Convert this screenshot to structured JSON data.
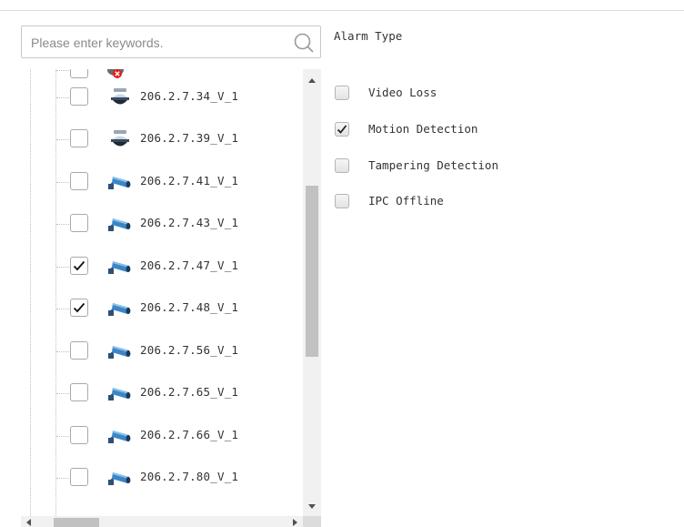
{
  "search": {
    "placeholder": "Please enter keywords."
  },
  "tree": {
    "items": [
      {
        "label": "206.2.7.34_V_1",
        "checked": false,
        "icon": "dome-camera-icon"
      },
      {
        "label": "206.2.7.39_V_1",
        "checked": false,
        "icon": "dome-camera-icon"
      },
      {
        "label": "206.2.7.41_V_1",
        "checked": false,
        "icon": "bullet-camera-icon"
      },
      {
        "label": "206.2.7.43_V_1",
        "checked": false,
        "icon": "bullet-camera-icon"
      },
      {
        "label": "206.2.7.47_V_1",
        "checked": true,
        "icon": "bullet-camera-icon"
      },
      {
        "label": "206.2.7.48_V_1",
        "checked": true,
        "icon": "bullet-camera-icon"
      },
      {
        "label": "206.2.7.56_V_1",
        "checked": false,
        "icon": "bullet-camera-icon"
      },
      {
        "label": "206.2.7.65_V_1",
        "checked": false,
        "icon": "bullet-camera-icon"
      },
      {
        "label": "206.2.7.66_V_1",
        "checked": false,
        "icon": "bullet-camera-icon"
      },
      {
        "label": "206.2.7.80_V_1",
        "checked": false,
        "icon": "bullet-camera-icon"
      }
    ]
  },
  "alarm_type": {
    "title": "Alarm Type",
    "options": [
      {
        "label": "Video Loss",
        "checked": false
      },
      {
        "label": "Motion Detection",
        "checked": true
      },
      {
        "label": "Tampering Detection",
        "checked": false
      },
      {
        "label": "IPC Offline",
        "checked": false
      }
    ]
  },
  "colors": {
    "border": "#c8c8c8",
    "camera_blue": "#3a87c8",
    "scrollbar_thumb": "#c1c1c1",
    "error_red": "#e02020"
  }
}
